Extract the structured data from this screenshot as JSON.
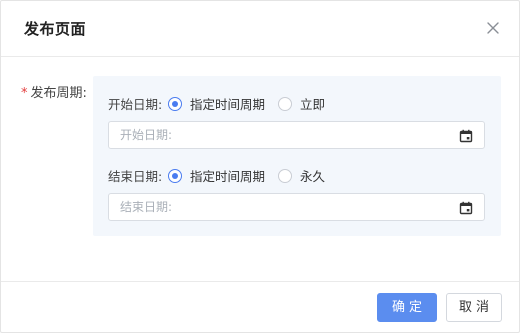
{
  "dialog": {
    "title": "发布页面",
    "close_icon": "close-icon"
  },
  "form": {
    "required_mark": "*",
    "publish_period_label": "发布周期:",
    "start": {
      "label": "开始日期:",
      "options": [
        {
          "label": "指定时间周期",
          "checked": true
        },
        {
          "label": "立即",
          "checked": false
        }
      ],
      "placeholder": "开始日期:",
      "value": ""
    },
    "end": {
      "label": "结束日期:",
      "options": [
        {
          "label": "指定时间周期",
          "checked": true
        },
        {
          "label": "永久",
          "checked": false
        }
      ],
      "placeholder": "结束日期:",
      "value": ""
    },
    "calendar_icon": "calendar-icon"
  },
  "footer": {
    "confirm_label": "确定",
    "cancel_label": "取消"
  },
  "colors": {
    "accent": "#5b8def",
    "radio_checked": "#4a7cf0",
    "required": "#e23b3b",
    "panel_bg": "#f3f7fc"
  }
}
